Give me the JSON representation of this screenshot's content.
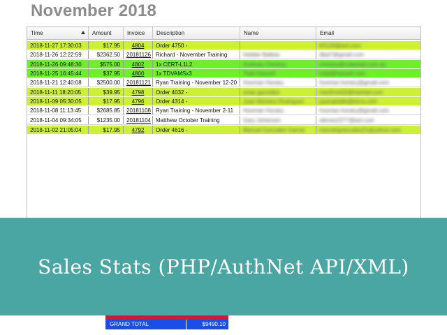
{
  "page": {
    "title": "November 2018"
  },
  "grid": {
    "columns": [
      "Time",
      "Amount",
      "Invoice",
      "Description",
      "Name",
      "Email"
    ],
    "sorted_column": "Time",
    "rows": [
      {
        "color": "yellow",
        "time": "2018-11-27 17:30:03",
        "amount": "$17.95",
        "invoice": "4804",
        "invoice_link": true,
        "description": "Order 4750 -",
        "name": "",
        "email": "kf1120@aol.com"
      },
      {
        "color": "white",
        "time": "2018-11-26 12:22:59",
        "amount": "$2362.50",
        "invoice": "20181126",
        "invoice_link": false,
        "description": "Richard - November Training",
        "name": "Debbie Balleta",
        "email": "dbal7@gmail.com"
      },
      {
        "color": "green",
        "time": "2018-11-26 09:48:30",
        "amount": "$575.00",
        "invoice": "4802",
        "invoice_link": true,
        "description": "1x CERT-L1L2",
        "name": "Andreas Christou",
        "email": "christou@cutaneat.com.au"
      },
      {
        "color": "green",
        "time": "2018-11-25 16:45:44",
        "amount": "$37.95",
        "invoice": "4800",
        "invoice_link": true,
        "description": "1x TDVAMSx3",
        "name": "Todd Hassell",
        "email": "todd@hassell.com"
      },
      {
        "color": "white",
        "time": "2018-11-21 12:40:08",
        "amount": "$2500.00",
        "invoice": "20181121",
        "invoice_link": false,
        "description": "Ryan Training - November 12-20",
        "name": "Hooman Honary",
        "email": "hooman.honary@gmail.com"
      },
      {
        "color": "yellow",
        "time": "2018-11-11 18:20:05",
        "amount": "$39.95",
        "invoice": "4798",
        "invoice_link": true,
        "description": "Order 4032 -",
        "name": "omar gonzalez",
        "email": "macfrm432@hotmail.com"
      },
      {
        "color": "yellow",
        "time": "2018-11-09 05:30:05",
        "amount": "$17.95",
        "invoice": "4796",
        "invoice_link": true,
        "description": "Order 4314 -",
        "name": "Juan Montero Rodriguez",
        "email": "jsparqetalle@terra.com"
      },
      {
        "color": "white",
        "time": "2018-11-08 11:13:45",
        "amount": "$2685.85",
        "invoice": "20181108",
        "invoice_link": false,
        "description": "Ryan Training - November 2-11",
        "name": "Hooman Honary",
        "email": "hooman.honary@gmail.com"
      },
      {
        "color": "white",
        "time": "2018-11-04 09:34:05",
        "amount": "$1235.00",
        "invoice": "20181104",
        "invoice_link": false,
        "description": "Matthew October Training",
        "name": "Gary Johansen",
        "email": "wlenes2277@aol.com"
      },
      {
        "color": "yellow",
        "time": "2018-11-02 21:05:04",
        "amount": "$17.95",
        "invoice": "4792",
        "invoice_link": true,
        "description": "Order 4616 -",
        "name": "Manuel Gonzalez Garcia",
        "email": "manolograncales21@yahoo.com"
      }
    ]
  },
  "banner": {
    "text": "Sales Stats (PHP/AuthNet API/XML)"
  },
  "totals": {
    "grand_total_label": "GRAND TOTAL",
    "grand_total_value": "$9490.10"
  },
  "colors": {
    "yellow_row": "#ccf036",
    "green_row": "#6df02a",
    "banner": "#4aa6a3",
    "total_blue": "#1a4ee8",
    "total_red": "#c81d3a"
  }
}
